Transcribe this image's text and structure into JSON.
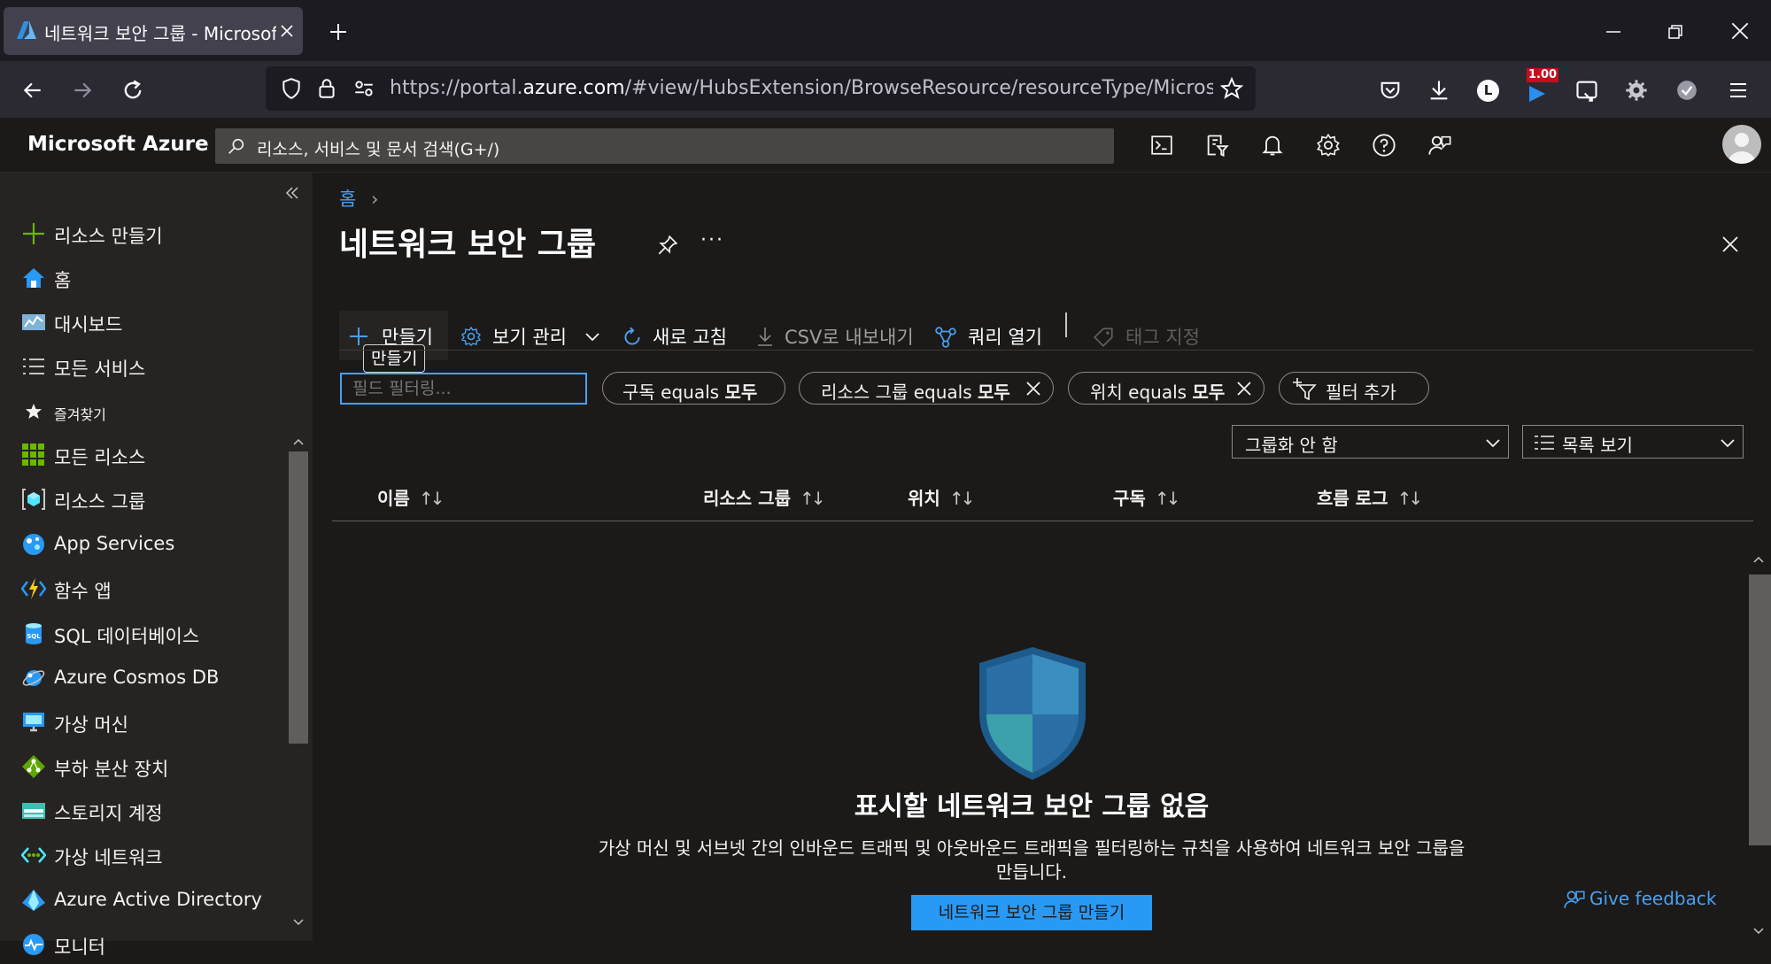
{
  "browser": {
    "tab_title": "네트워크 보안 그룹 - Microsoft Azure",
    "url_prefix": "https://portal.",
    "url_domain": "azure.com",
    "url_rest": "/#view/HubsExtension/BrowseResource/resourceType/Microsoft.Network",
    "ext_badge": "1.00",
    "profile_letter": "L"
  },
  "header": {
    "brand": "Microsoft Azure",
    "search_placeholder": "리소스, 서비스 및 문서 검색(G+/)"
  },
  "sidebar": {
    "items": [
      {
        "label": "리소스 만들기",
        "icon": "plus-icon"
      },
      {
        "label": "홈",
        "icon": "home-icon"
      },
      {
        "label": "대시보드",
        "icon": "dashboard-icon"
      },
      {
        "label": "모든 서비스",
        "icon": "list-icon"
      },
      {
        "label": "즐겨찾기",
        "icon": "star-icon"
      },
      {
        "label": "모든 리소스",
        "icon": "grid-icon"
      },
      {
        "label": "리소스 그룹",
        "icon": "resource-group-icon"
      },
      {
        "label": "App Services",
        "icon": "app-services-icon"
      },
      {
        "label": "함수 앱",
        "icon": "function-app-icon"
      },
      {
        "label": "SQL 데이터베이스",
        "icon": "sql-database-icon"
      },
      {
        "label": "Azure Cosmos DB",
        "icon": "cosmos-db-icon"
      },
      {
        "label": "가상 머신",
        "icon": "virtual-machine-icon"
      },
      {
        "label": "부하 분산 장치",
        "icon": "load-balancer-icon"
      },
      {
        "label": "스토리지 계정",
        "icon": "storage-account-icon"
      },
      {
        "label": "가상 네트워크",
        "icon": "virtual-network-icon"
      },
      {
        "label": "Azure Active Directory",
        "icon": "active-directory-icon"
      },
      {
        "label": "모니터",
        "icon": "monitor-icon"
      }
    ]
  },
  "main": {
    "breadcrumb": "홈",
    "title": "네트워크 보안 그룹",
    "toolbar": {
      "create": "만들기",
      "create_tooltip": "만들기",
      "manage_view": "보기 관리",
      "refresh": "새로 고침",
      "export_csv": "CSV로 내보내기",
      "open_query": "쿼리 열기",
      "assign_tags": "태그 지정"
    },
    "filter_placeholder": "필드 필터링...",
    "pills": [
      {
        "prefix": "구독 equals ",
        "value": "모두"
      },
      {
        "prefix": "리소스 그룹 equals ",
        "value": "모두"
      },
      {
        "prefix": "위치 equals ",
        "value": "모두"
      }
    ],
    "add_filter": "필터 추가",
    "grouping": "그룹화 안 함",
    "view_mode": "목록 보기",
    "columns": [
      "이름",
      "리소스 그룹",
      "위치",
      "구독",
      "흐름 로그"
    ],
    "empty": {
      "heading": "표시할 네트워크 보안 그룹 없음",
      "desc_line1": "가상 머신 및 서브넷 간의 인바운드 트래픽 및 아웃바운드 트래픽을 필터링하는 규칙을 사용하여 네트워크 보안 그룹을",
      "desc_line2": "만듭니다.",
      "create_button": "네트워크 보안 그룹 만들기"
    },
    "feedback": "Give feedback"
  },
  "colors": {
    "accent": "#2899f5",
    "link": "#4aa0f0",
    "bg": "#1b1a19"
  }
}
